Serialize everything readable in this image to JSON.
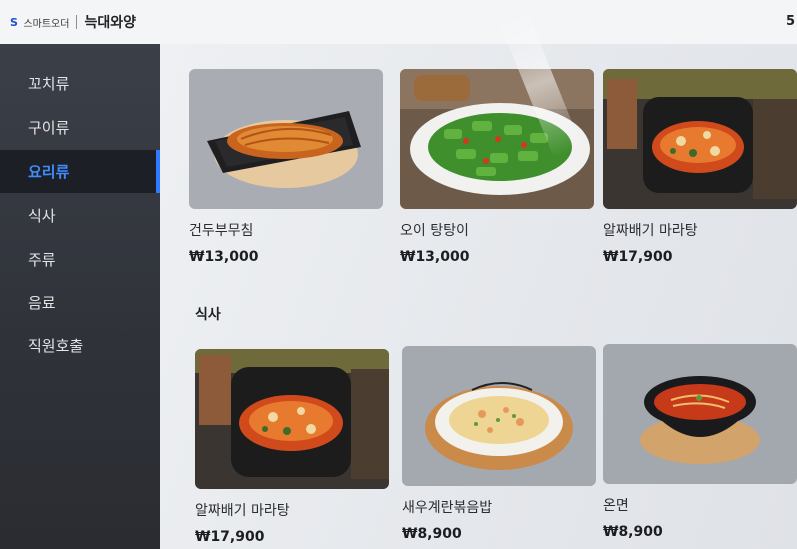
{
  "header": {
    "brand_mark": "S",
    "brand_small": "스마트오더",
    "store_name": "늑대와양",
    "right_text": "5"
  },
  "sidebar": {
    "items": [
      {
        "label": "꼬치류"
      },
      {
        "label": "구이류"
      },
      {
        "label": "요리류"
      },
      {
        "label": "식사"
      },
      {
        "label": "주류"
      },
      {
        "label": "음료"
      },
      {
        "label": "직원호출"
      }
    ],
    "active_index": 2
  },
  "main": {
    "section_meal_title": "식사",
    "cards_top": [
      {
        "name": "건두부무침",
        "price": "₩13,000"
      },
      {
        "name": "오이 탕탕이",
        "price": "₩13,000"
      },
      {
        "name": "알짜배기 마라탕",
        "price": "₩17,900"
      }
    ],
    "cards_meal": [
      {
        "name": "알짜배기 마라탕",
        "price": "₩17,900"
      },
      {
        "name": "새우계란볶음밥",
        "price": "₩8,900"
      },
      {
        "name": "온면",
        "price": "₩8,900"
      }
    ]
  },
  "colors": {
    "accent": "#2f7bff",
    "sidebar_bg": "#3b3f47",
    "header_bg": "#f4f5f7",
    "content_bg": "#eef0f3"
  }
}
